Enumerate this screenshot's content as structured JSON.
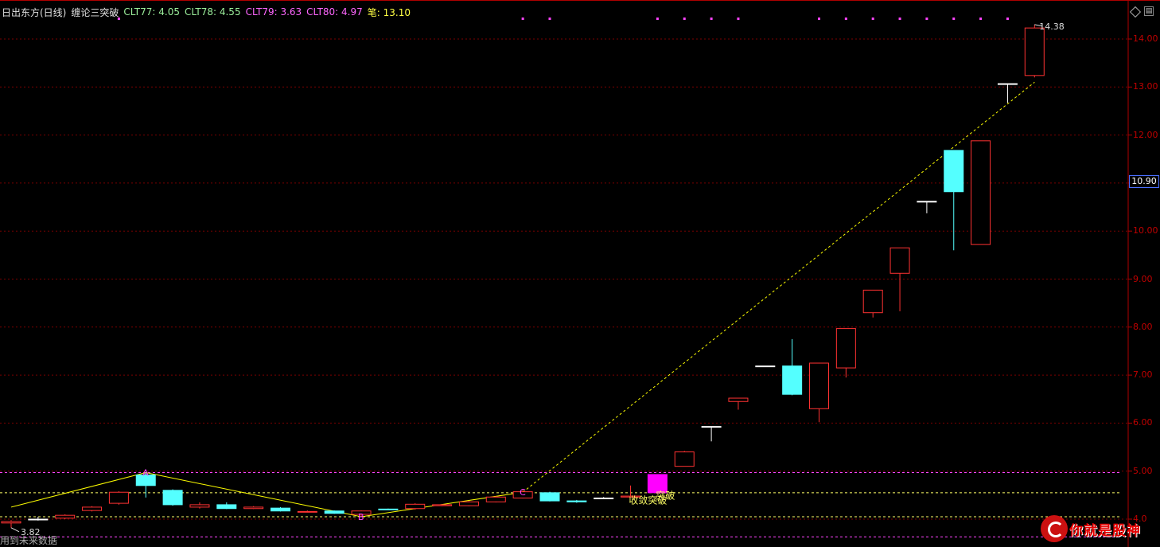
{
  "header": {
    "stock_title": "日出东方(日线)",
    "indicator_name": "缠论三突破",
    "clt77": "CLT77: 4.05",
    "clt78": "CLT78: 4.55",
    "clt79": "CLT79: 3.63",
    "clt80": "CLT80: 4.97",
    "bi": "笔: 13.10",
    "colors": {
      "clt77": "#00ff00",
      "clt78": "#00ff00",
      "clt79": "#ff00ff",
      "clt80": "#ff00ff",
      "bi": "#ffff00"
    }
  },
  "icons": [
    "diamond-icon",
    "window-icon"
  ],
  "current_price_label": "10.90",
  "footer_note": "用到未来数据",
  "watermark_text": "你就是股神",
  "chart_data": {
    "type": "candlestick",
    "y_ticks": [
      "14.00",
      "13.00",
      "12.00",
      "11.00",
      "10.00",
      "9.00",
      "8.00",
      "7.00",
      "6.00",
      "5.00",
      "4.0"
    ],
    "y_tick_values": [
      14,
      13,
      12,
      11,
      10,
      9,
      8,
      7,
      6,
      5,
      4
    ],
    "ylim": [
      3.6,
      14.6
    ],
    "grid": true,
    "candles": [
      {
        "o": 3.92,
        "c": 3.95,
        "h": 3.98,
        "l": 3.82
      },
      {
        "o": 4.0,
        "c": 4.0,
        "h": 4.05,
        "l": 3.97
      },
      {
        "o": 4.02,
        "c": 4.08,
        "h": 4.1,
        "l": 4.0
      },
      {
        "o": 4.18,
        "c": 4.25,
        "h": 4.27,
        "l": 4.16
      },
      {
        "o": 4.33,
        "c": 4.56,
        "h": 4.58,
        "l": 4.3
      },
      {
        "o": 4.92,
        "c": 4.7,
        "h": 4.97,
        "l": 4.45
      },
      {
        "o": 4.6,
        "c": 4.3,
        "h": 4.62,
        "l": 4.28
      },
      {
        "o": 4.25,
        "c": 4.3,
        "h": 4.35,
        "l": 4.22
      },
      {
        "o": 4.3,
        "c": 4.22,
        "h": 4.35,
        "l": 4.21
      },
      {
        "o": 4.22,
        "c": 4.25,
        "h": 4.27,
        "l": 4.21
      },
      {
        "o": 4.23,
        "c": 4.17,
        "h": 4.25,
        "l": 4.16
      },
      {
        "o": 4.15,
        "c": 4.16,
        "h": 4.18,
        "l": 4.14
      },
      {
        "o": 4.17,
        "c": 4.12,
        "h": 4.18,
        "l": 4.11
      },
      {
        "o": 4.1,
        "c": 4.17,
        "h": 4.18,
        "l": 4.05
      },
      {
        "o": 4.21,
        "c": 4.2,
        "h": 4.22,
        "l": 4.19
      },
      {
        "o": 4.22,
        "c": 4.31,
        "h": 4.33,
        "l": 4.2
      },
      {
        "o": 4.28,
        "c": 4.3,
        "h": 4.31,
        "l": 4.27
      },
      {
        "o": 4.28,
        "c": 4.36,
        "h": 4.38,
        "l": 4.27
      },
      {
        "o": 4.36,
        "c": 4.46,
        "h": 4.48,
        "l": 4.35
      },
      {
        "o": 4.44,
        "c": 4.57,
        "h": 4.62,
        "l": 4.43
      },
      {
        "o": 4.55,
        "c": 4.38,
        "h": 4.57,
        "l": 4.37
      },
      {
        "o": 4.38,
        "c": 4.36,
        "h": 4.4,
        "l": 4.34
      },
      {
        "o": 4.44,
        "c": 4.44,
        "h": 4.46,
        "l": 4.42
      },
      {
        "o": 4.46,
        "c": 4.48,
        "h": 4.7,
        "l": 4.46
      },
      {
        "o": 4.93,
        "c": 4.55,
        "h": 4.93,
        "l": 4.53
      },
      {
        "o": 5.1,
        "c": 5.4,
        "h": 5.42,
        "l": 5.1
      },
      {
        "o": 5.93,
        "c": 5.93,
        "h": 5.93,
        "l": 5.62
      },
      {
        "o": 6.45,
        "c": 6.52,
        "h": 6.52,
        "l": 6.28
      },
      {
        "o": 7.19,
        "c": 7.19,
        "h": 7.19,
        "l": 7.19
      },
      {
        "o": 7.19,
        "c": 6.6,
        "h": 7.75,
        "l": 6.58
      },
      {
        "o": 6.3,
        "c": 7.25,
        "h": 7.25,
        "l": 6.02
      },
      {
        "o": 7.15,
        "c": 7.97,
        "h": 7.97,
        "l": 6.95
      },
      {
        "o": 8.3,
        "c": 8.77,
        "h": 8.77,
        "l": 8.2
      },
      {
        "o": 9.12,
        "c": 9.65,
        "h": 9.65,
        "l": 8.33
      },
      {
        "o": 10.62,
        "c": 10.62,
        "h": 10.62,
        "l": 10.37
      },
      {
        "o": 11.68,
        "c": 10.82,
        "h": 11.68,
        "l": 9.6
      },
      {
        "o": 9.72,
        "c": 11.88,
        "h": 11.88,
        "l": 9.72
      },
      {
        "o": 13.07,
        "c": 13.07,
        "h": 13.07,
        "l": 12.67
      },
      {
        "o": 13.24,
        "c": 14.23,
        "h": 14.3,
        "l": 13.2
      }
    ],
    "bi_line_points": [
      {
        "i": 0,
        "v": 4.25
      },
      {
        "i": 5,
        "v": 4.97
      },
      {
        "i": 13,
        "v": 4.05
      },
      {
        "i": 19,
        "v": 4.56
      }
    ],
    "bi_dashed_points": [
      {
        "i": 19,
        "v": 4.56
      },
      {
        "i": 38,
        "v": 13.1
      }
    ],
    "bi_markers": [
      {
        "i": 5,
        "v": 4.97,
        "label": "A"
      },
      {
        "i": 13,
        "v": 4.05,
        "label": "B"
      },
      {
        "i": 19,
        "v": 4.56,
        "label": "C"
      }
    ],
    "h_lines": [
      {
        "v": 4.97,
        "color": "#ff44ff"
      },
      {
        "v": 4.55,
        "color": "#ffff66"
      },
      {
        "v": 4.05,
        "color": "#ffff66"
      },
      {
        "v": 3.63,
        "color": "#ff44ff"
      }
    ],
    "breakout_candle": {
      "i": 24,
      "color": "#ff00ff"
    },
    "breakout_labels": [
      "收敛突破",
      "突破"
    ],
    "low_label": "3.82",
    "high_label": "14.38",
    "top_dots_x_index": [
      4,
      19,
      20,
      24,
      25,
      26,
      27,
      30,
      31,
      32,
      33,
      34,
      35,
      36,
      37
    ],
    "colors": {
      "up": "#ff3232",
      "down": "#54ffff",
      "doji": "#ffffff",
      "grid": "#7a0000",
      "bi_line": "#ffff00",
      "marker": "#ff44ff"
    }
  }
}
